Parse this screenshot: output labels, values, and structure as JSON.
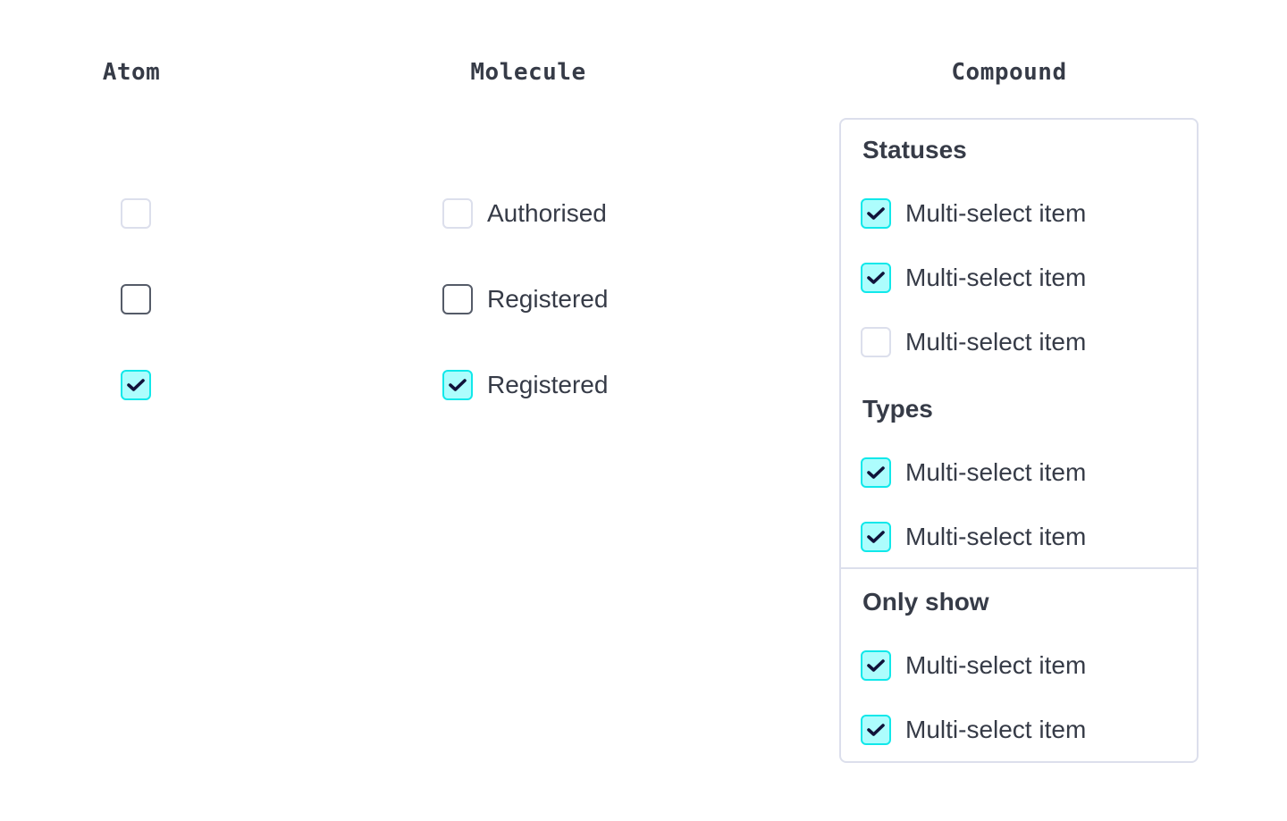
{
  "columns": {
    "atom": "Atom",
    "molecule": "Molecule",
    "compound": "Compound"
  },
  "colors": {
    "checked_fill": "#adfdfd",
    "checked_border": "#10e8ea",
    "checkmark": "#10133a",
    "unchecked_border": "#555b68",
    "disabled_border": "#dcdfec",
    "text": "#363b47"
  },
  "atom": {
    "checkboxes": [
      {
        "state": "disabled"
      },
      {
        "state": "unchecked"
      },
      {
        "state": "checked"
      }
    ]
  },
  "molecule": {
    "items": [
      {
        "label": "Authorised",
        "state": "disabled"
      },
      {
        "label": "Registered",
        "state": "unchecked"
      },
      {
        "label": "Registered",
        "state": "checked"
      }
    ]
  },
  "compound": {
    "sections": [
      {
        "heading": "Statuses",
        "items": [
          {
            "label": "Multi-select item",
            "state": "checked"
          },
          {
            "label": "Multi-select item",
            "state": "checked"
          },
          {
            "label": "Multi-select item",
            "state": "disabled"
          }
        ]
      },
      {
        "heading": "Types",
        "items": [
          {
            "label": "Multi-select item",
            "state": "checked"
          },
          {
            "label": "Multi-select item",
            "state": "checked"
          }
        ]
      },
      {
        "heading": "Only show",
        "items": [
          {
            "label": "Multi-select item",
            "state": "checked"
          },
          {
            "label": "Multi-select item",
            "state": "checked"
          }
        ]
      }
    ]
  }
}
